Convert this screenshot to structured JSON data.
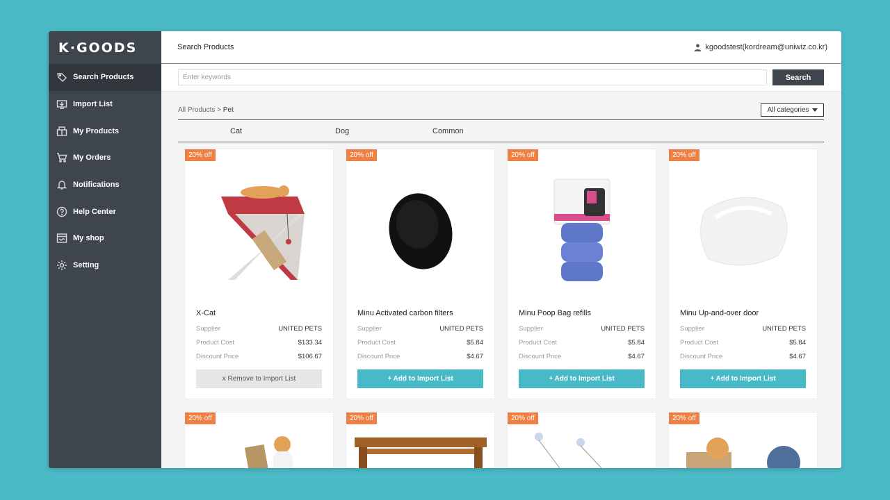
{
  "app": {
    "logo": "K·GOODS"
  },
  "sidebar": {
    "items": [
      {
        "label": "Search Products",
        "icon": "tag-icon",
        "active": true
      },
      {
        "label": "Import List",
        "icon": "import-icon"
      },
      {
        "label": "My Products",
        "icon": "products-icon"
      },
      {
        "label": "My Orders",
        "icon": "cart-icon"
      },
      {
        "label": "Notifications",
        "icon": "bell-icon"
      },
      {
        "label": "Help Center",
        "icon": "help-icon"
      },
      {
        "label": "My shop",
        "icon": "shop-icon"
      },
      {
        "label": "Setting",
        "icon": "gear-icon"
      }
    ]
  },
  "header": {
    "title": "Search Products",
    "user": "kgoodstest(kordream@uniwiz.co.kr)"
  },
  "search": {
    "placeholder": "Enter keywords",
    "button": "Search"
  },
  "breadcrumb": {
    "root": "All Products",
    "sep": " > ",
    "current": "Pet"
  },
  "category_select": {
    "value": "All categories"
  },
  "tabs": [
    "Cat",
    "Dog",
    "Common"
  ],
  "labels": {
    "supplier": "Supplier",
    "cost": "Product Cost",
    "discount": "Discount Price"
  },
  "products": [
    {
      "badge": "20% off",
      "name": "X-Cat",
      "supplier": "UNITED PETS",
      "cost": "$133.34",
      "discount": "$106.67",
      "action": "x Remove to Import List",
      "in_list": true
    },
    {
      "badge": "20% off",
      "name": "Minu Activated carbon filters",
      "supplier": "UNITED PETS",
      "cost": "$5.84",
      "discount": "$4.67",
      "action": "+ Add to Import List",
      "in_list": false
    },
    {
      "badge": "20% off",
      "name": "Minu Poop Bag refills",
      "supplier": "UNITED PETS",
      "cost": "$5.84",
      "discount": "$4.67",
      "action": "+ Add to Import List",
      "in_list": false
    },
    {
      "badge": "20% off",
      "name": "Minu Up-and-over door",
      "supplier": "UNITED PETS",
      "cost": "$5.84",
      "discount": "$4.67",
      "action": "+ Add to Import List",
      "in_list": false
    }
  ],
  "products_row2": [
    {
      "badge": "20% off"
    },
    {
      "badge": "20% off"
    },
    {
      "badge": "20% off"
    },
    {
      "badge": "20% off"
    }
  ],
  "colors": {
    "accent": "#48b9c6",
    "sidebar": "#3f454c",
    "badge": "#ee7f45",
    "background": "#4bbac7"
  }
}
